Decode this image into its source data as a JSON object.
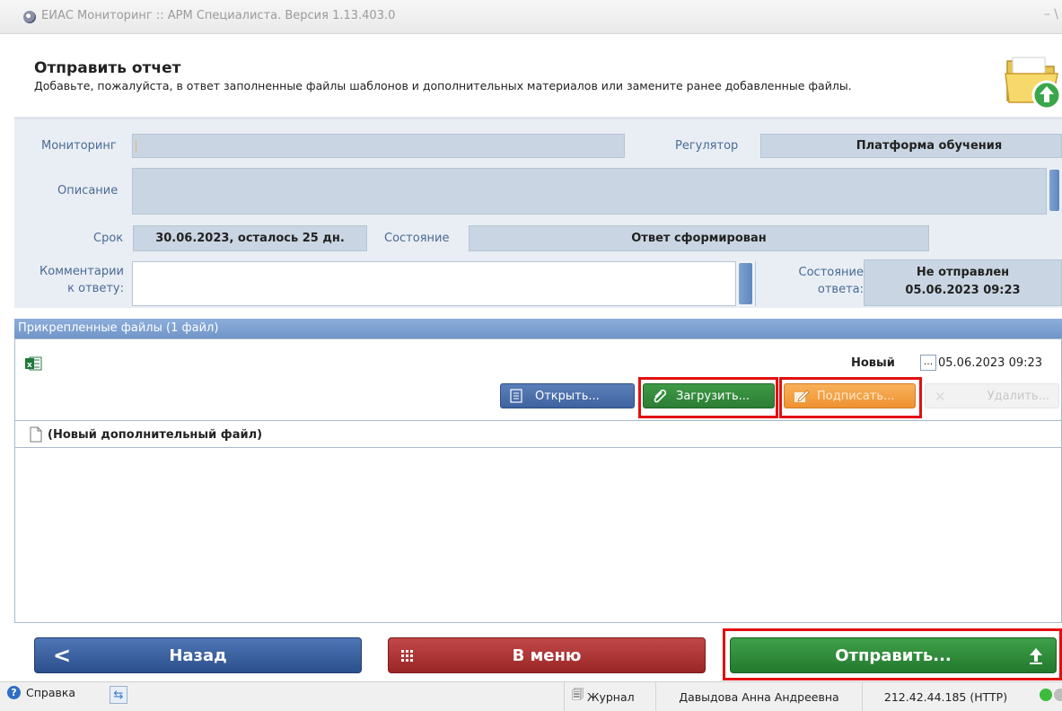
{
  "window": {
    "title": "ЕИАС Мониторинг :: АРМ Специалиста. Версия 1.13.403.0",
    "controls": "– \\"
  },
  "header": {
    "title": "Отправить отчет",
    "subtitle": "Добавьте, пожалуйста, в ответ заполненные файлы шаблонов и дополнительных материалов или замените ранее добавленные файлы."
  },
  "form": {
    "monitoring_label": "Мониторинг",
    "monitoring_value": "",
    "regulator_label": "Регулятор",
    "regulator_value": "Платформа обучения",
    "description_label": "Описание",
    "description_value": "",
    "deadline_label": "Срок",
    "deadline_value": "30.06.2023, осталось 25 дн.",
    "state_label": "Состояние",
    "state_value": "Ответ сформирован",
    "comment_label_1": "Комментарии",
    "comment_label_2": "к ответу:",
    "comment_value": "",
    "answer_state_label_1": "Состояние",
    "answer_state_label_2": "ответа:",
    "answer_state_line1": "Не отправлен",
    "answer_state_line2": "05.06.2023 09:23"
  },
  "files": {
    "header": "Прикрепленные файлы (1 файл)",
    "file_status": "Новый",
    "file_date_prefix": "...",
    "file_date": "05.06.2023 09:23",
    "buttons": {
      "open": "Открыть...",
      "upload": "Загрузить...",
      "sign": "Подписать...",
      "delete": "Удалить..."
    },
    "new_file_label": "(Новый дополнительный файл)"
  },
  "bottom": {
    "back": "Назад",
    "menu": "В меню",
    "send": "Отправить..."
  },
  "statusbar": {
    "help": "Справка",
    "journal": "Журнал",
    "user": "Давыдова Анна Андреевна",
    "server": "212.42.44.185 (HTTP)"
  },
  "colors": {
    "highlight": "#e31010",
    "open_button": "#3f63a0",
    "upload_button": "#2c7d34",
    "sign_button": "#ef9232",
    "back_button": "#2c4f8d",
    "menu_button": "#9a2626",
    "send_button": "#237a2d",
    "files_header": "#6f95c7",
    "status_online": "#3cbb3c"
  }
}
